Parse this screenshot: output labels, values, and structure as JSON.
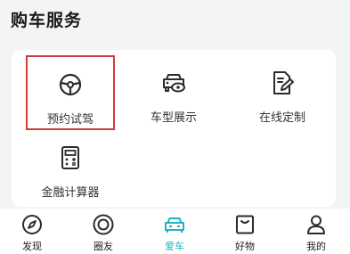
{
  "section": {
    "title": "购车服务"
  },
  "services": [
    {
      "label": "预约试驾",
      "icon": "steering-wheel-icon",
      "selected": true
    },
    {
      "label": "车型展示",
      "icon": "car-eye-icon",
      "selected": false
    },
    {
      "label": "在线定制",
      "icon": "edit-document-icon",
      "selected": false
    },
    {
      "label": "金融计算器",
      "icon": "calculator-icon",
      "selected": false
    }
  ],
  "tabbar": {
    "accent_color": "#22b3c2",
    "items": [
      {
        "label": "发现",
        "icon": "compass-icon",
        "active": false
      },
      {
        "label": "圈友",
        "icon": "community-circle-icon",
        "active": false
      },
      {
        "label": "爱车",
        "icon": "car-icon",
        "active": true
      },
      {
        "label": "好物",
        "icon": "shopping-box-icon",
        "active": false
      },
      {
        "label": "我的",
        "icon": "person-icon",
        "active": false
      }
    ]
  }
}
